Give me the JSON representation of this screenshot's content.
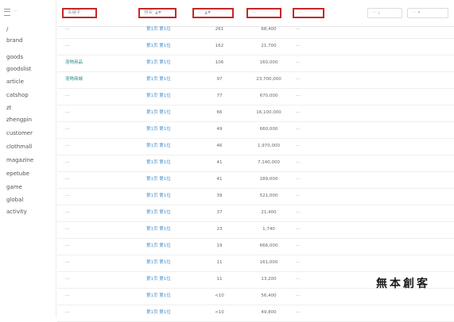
{
  "sidebar": {
    "header": "···",
    "items": [
      "/",
      "brand",
      "goods",
      "goodslist",
      "article",
      "catshop",
      "zt",
      "zhengpin",
      "customer",
      "clothmall",
      "magazine",
      "epetube",
      "game",
      "global",
      "activity"
    ]
  },
  "table": {
    "headers": {
      "keyword": "关键字",
      "rank": "排名",
      "rank_sort": "▲▼",
      "pc_volume": "···",
      "pc_volume_sort": "▲▼",
      "index": "···",
      "title": "···"
    },
    "actions": [
      {
        "label": "···",
        "glyph": "⤓"
      },
      {
        "label": "···",
        "glyph": "▾"
      }
    ],
    "rows": [
      {
        "keyword": "···",
        "rank": "第1页 第1位",
        "pc": "261",
        "index": "68,400",
        "title": "···"
      },
      {
        "keyword": "···",
        "rank": "第1页 第1位",
        "pc": "162",
        "index": "21,700",
        "title": "···"
      },
      {
        "keyword": "宠物用品",
        "rank": "第1页 第1位",
        "pc": "106",
        "index": "160,000",
        "title": "···"
      },
      {
        "keyword": "宠物商城",
        "rank": "第1页 第1位",
        "pc": "97",
        "index": "23,700,000",
        "title": "···"
      },
      {
        "keyword": "···",
        "rank": "第1页 第1位",
        "pc": "77",
        "index": "670,000",
        "title": "···"
      },
      {
        "keyword": "···",
        "rank": "第1页 第1位",
        "pc": "66",
        "index": "16,100,000",
        "title": "···"
      },
      {
        "keyword": "···",
        "rank": "第1页 第1位",
        "pc": "49",
        "index": "660,000",
        "title": "···"
      },
      {
        "keyword": "···",
        "rank": "第1页 第1位",
        "pc": "46",
        "index": "1,970,000",
        "title": "···"
      },
      {
        "keyword": "···",
        "rank": "第1页 第1位",
        "pc": "41",
        "index": "7,140,000",
        "title": "···"
      },
      {
        "keyword": "···",
        "rank": "第1页 第1位",
        "pc": "41",
        "index": "189,000",
        "title": "···"
      },
      {
        "keyword": "···",
        "rank": "第1页 第1位",
        "pc": "39",
        "index": "521,000",
        "title": "···"
      },
      {
        "keyword": "···",
        "rank": "第1页 第1位",
        "pc": "37",
        "index": "21,400",
        "title": "···"
      },
      {
        "keyword": "···",
        "rank": "第1页 第1位",
        "pc": "23",
        "index": "1,740",
        "title": "···"
      },
      {
        "keyword": "···",
        "rank": "第1页 第1位",
        "pc": "19",
        "index": "666,000",
        "title": "···"
      },
      {
        "keyword": "···",
        "rank": "第1页 第1位",
        "pc": "11",
        "index": "161,000",
        "title": "···"
      },
      {
        "keyword": "···",
        "rank": "第1页 第1位",
        "pc": "11",
        "index": "13,200",
        "title": "···"
      },
      {
        "keyword": "···",
        "rank": "第1页 第1位",
        "pc": "<10",
        "index": "56,400",
        "title": "···"
      },
      {
        "keyword": "···",
        "rank": "第1页 第1位",
        "pc": "<10",
        "index": "49,800",
        "title": "···"
      }
    ]
  },
  "watermark": "無本創客"
}
